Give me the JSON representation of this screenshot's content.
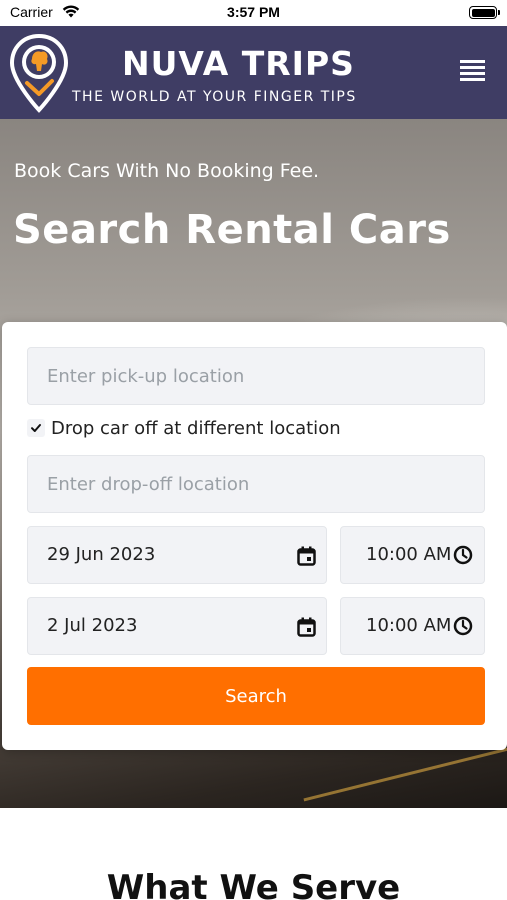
{
  "status_bar": {
    "carrier": "Carrier",
    "time": "3:57 PM"
  },
  "header": {
    "brand_title": "NUVA TRIPS",
    "tagline": "THE WORLD AT YOUR FINGER TIPS",
    "background_color": "#3f3d64",
    "logo_icon": "location-pin-globe-icon",
    "menu_icon": "hamburger-menu-icon"
  },
  "hero": {
    "subtitle": "Book Cars With No Booking Fee.",
    "title": "Search Rental Cars"
  },
  "search_form": {
    "pickup_location_placeholder": "Enter pick-up location",
    "different_dropoff_label": "Drop car off at different location",
    "different_dropoff_checked": true,
    "dropoff_location_placeholder": "Enter drop-off location",
    "pickup_date": "29 Jun 2023",
    "pickup_time": "10:00 AM",
    "dropoff_date": "2 Jul 2023",
    "dropoff_time": "10:00 AM",
    "search_button_label": "Search",
    "accent_color": "#ff6f00"
  },
  "section": {
    "title": "What We Serve"
  }
}
